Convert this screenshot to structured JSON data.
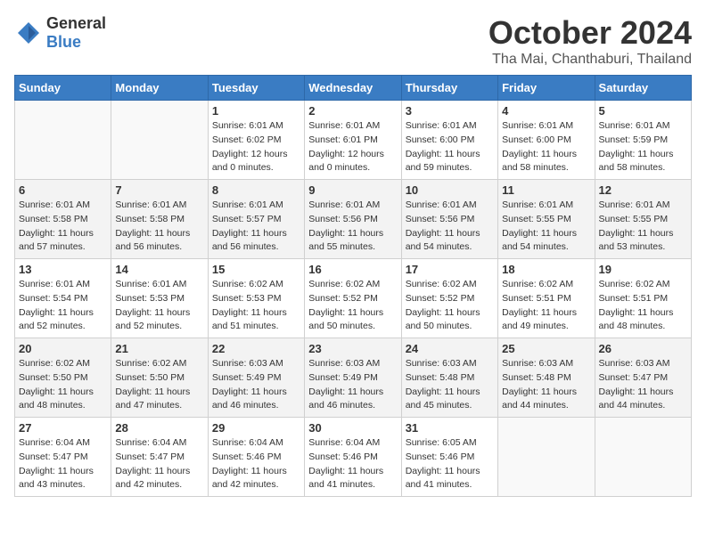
{
  "header": {
    "logo": {
      "general": "General",
      "blue": "Blue"
    },
    "title": "October 2024",
    "location": "Tha Mai, Chanthaburi, Thailand"
  },
  "weekdays": [
    "Sunday",
    "Monday",
    "Tuesday",
    "Wednesday",
    "Thursday",
    "Friday",
    "Saturday"
  ],
  "weeks": [
    {
      "shaded": false,
      "days": [
        {
          "date": "",
          "info": ""
        },
        {
          "date": "",
          "info": ""
        },
        {
          "date": "1",
          "info": "Sunrise: 6:01 AM\nSunset: 6:02 PM\nDaylight: 12 hours\nand 0 minutes."
        },
        {
          "date": "2",
          "info": "Sunrise: 6:01 AM\nSunset: 6:01 PM\nDaylight: 12 hours\nand 0 minutes."
        },
        {
          "date": "3",
          "info": "Sunrise: 6:01 AM\nSunset: 6:00 PM\nDaylight: 11 hours\nand 59 minutes."
        },
        {
          "date": "4",
          "info": "Sunrise: 6:01 AM\nSunset: 6:00 PM\nDaylight: 11 hours\nand 58 minutes."
        },
        {
          "date": "5",
          "info": "Sunrise: 6:01 AM\nSunset: 5:59 PM\nDaylight: 11 hours\nand 58 minutes."
        }
      ]
    },
    {
      "shaded": true,
      "days": [
        {
          "date": "6",
          "info": "Sunrise: 6:01 AM\nSunset: 5:58 PM\nDaylight: 11 hours\nand 57 minutes."
        },
        {
          "date": "7",
          "info": "Sunrise: 6:01 AM\nSunset: 5:58 PM\nDaylight: 11 hours\nand 56 minutes."
        },
        {
          "date": "8",
          "info": "Sunrise: 6:01 AM\nSunset: 5:57 PM\nDaylight: 11 hours\nand 56 minutes."
        },
        {
          "date": "9",
          "info": "Sunrise: 6:01 AM\nSunset: 5:56 PM\nDaylight: 11 hours\nand 55 minutes."
        },
        {
          "date": "10",
          "info": "Sunrise: 6:01 AM\nSunset: 5:56 PM\nDaylight: 11 hours\nand 54 minutes."
        },
        {
          "date": "11",
          "info": "Sunrise: 6:01 AM\nSunset: 5:55 PM\nDaylight: 11 hours\nand 54 minutes."
        },
        {
          "date": "12",
          "info": "Sunrise: 6:01 AM\nSunset: 5:55 PM\nDaylight: 11 hours\nand 53 minutes."
        }
      ]
    },
    {
      "shaded": false,
      "days": [
        {
          "date": "13",
          "info": "Sunrise: 6:01 AM\nSunset: 5:54 PM\nDaylight: 11 hours\nand 52 minutes."
        },
        {
          "date": "14",
          "info": "Sunrise: 6:01 AM\nSunset: 5:53 PM\nDaylight: 11 hours\nand 52 minutes."
        },
        {
          "date": "15",
          "info": "Sunrise: 6:02 AM\nSunset: 5:53 PM\nDaylight: 11 hours\nand 51 minutes."
        },
        {
          "date": "16",
          "info": "Sunrise: 6:02 AM\nSunset: 5:52 PM\nDaylight: 11 hours\nand 50 minutes."
        },
        {
          "date": "17",
          "info": "Sunrise: 6:02 AM\nSunset: 5:52 PM\nDaylight: 11 hours\nand 50 minutes."
        },
        {
          "date": "18",
          "info": "Sunrise: 6:02 AM\nSunset: 5:51 PM\nDaylight: 11 hours\nand 49 minutes."
        },
        {
          "date": "19",
          "info": "Sunrise: 6:02 AM\nSunset: 5:51 PM\nDaylight: 11 hours\nand 48 minutes."
        }
      ]
    },
    {
      "shaded": true,
      "days": [
        {
          "date": "20",
          "info": "Sunrise: 6:02 AM\nSunset: 5:50 PM\nDaylight: 11 hours\nand 48 minutes."
        },
        {
          "date": "21",
          "info": "Sunrise: 6:02 AM\nSunset: 5:50 PM\nDaylight: 11 hours\nand 47 minutes."
        },
        {
          "date": "22",
          "info": "Sunrise: 6:03 AM\nSunset: 5:49 PM\nDaylight: 11 hours\nand 46 minutes."
        },
        {
          "date": "23",
          "info": "Sunrise: 6:03 AM\nSunset: 5:49 PM\nDaylight: 11 hours\nand 46 minutes."
        },
        {
          "date": "24",
          "info": "Sunrise: 6:03 AM\nSunset: 5:48 PM\nDaylight: 11 hours\nand 45 minutes."
        },
        {
          "date": "25",
          "info": "Sunrise: 6:03 AM\nSunset: 5:48 PM\nDaylight: 11 hours\nand 44 minutes."
        },
        {
          "date": "26",
          "info": "Sunrise: 6:03 AM\nSunset: 5:47 PM\nDaylight: 11 hours\nand 44 minutes."
        }
      ]
    },
    {
      "shaded": false,
      "days": [
        {
          "date": "27",
          "info": "Sunrise: 6:04 AM\nSunset: 5:47 PM\nDaylight: 11 hours\nand 43 minutes."
        },
        {
          "date": "28",
          "info": "Sunrise: 6:04 AM\nSunset: 5:47 PM\nDaylight: 11 hours\nand 42 minutes."
        },
        {
          "date": "29",
          "info": "Sunrise: 6:04 AM\nSunset: 5:46 PM\nDaylight: 11 hours\nand 42 minutes."
        },
        {
          "date": "30",
          "info": "Sunrise: 6:04 AM\nSunset: 5:46 PM\nDaylight: 11 hours\nand 41 minutes."
        },
        {
          "date": "31",
          "info": "Sunrise: 6:05 AM\nSunset: 5:46 PM\nDaylight: 11 hours\nand 41 minutes."
        },
        {
          "date": "",
          "info": ""
        },
        {
          "date": "",
          "info": ""
        }
      ]
    }
  ]
}
